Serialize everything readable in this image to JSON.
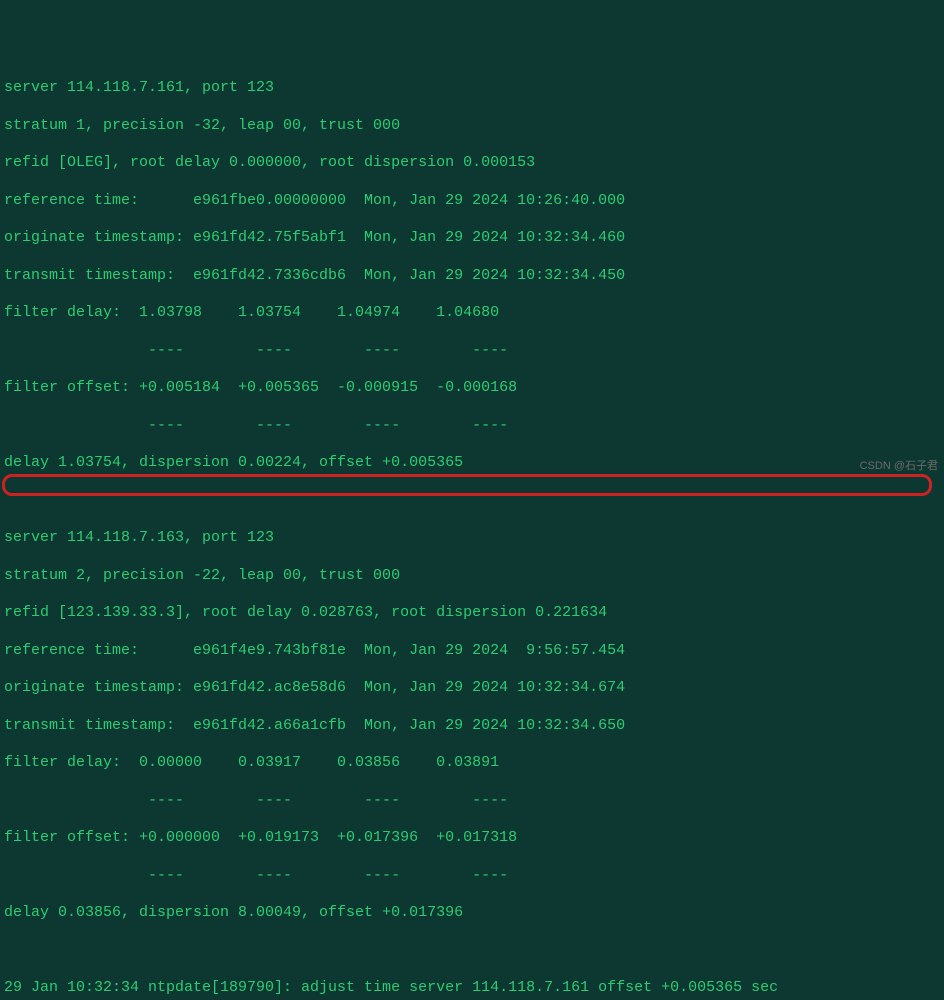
{
  "server1": {
    "header": "server 114.118.7.161, port 123",
    "stratum": "stratum 1, precision -32, leap 00, trust 000",
    "refid": "refid [OLEG], root delay 0.000000, root dispersion 0.000153",
    "reference_time": "reference time:      e961fbe0.00000000  Mon, Jan 29 2024 10:26:40.000",
    "originate_ts": "originate timestamp: e961fd42.75f5abf1  Mon, Jan 29 2024 10:32:34.460",
    "transmit_ts": "transmit timestamp:  e961fd42.7336cdb6  Mon, Jan 29 2024 10:32:34.450",
    "filter_delay": "filter delay:  1.03798    1.03754    1.04974    1.04680",
    "filter_delay_dashes": "                ----        ----        ----        ----",
    "filter_offset": "filter offset: +0.005184  +0.005365  -0.000915  -0.000168",
    "filter_offset_dashes": "                ----        ----        ----        ----",
    "summary": "delay 1.03754, dispersion 0.00224, offset +0.005365"
  },
  "server2": {
    "header": "server 114.118.7.163, port 123",
    "stratum": "stratum 2, precision -22, leap 00, trust 000",
    "refid": "refid [123.139.33.3], root delay 0.028763, root dispersion 0.221634",
    "reference_time": "reference time:      e961f4e9.743bf81e  Mon, Jan 29 2024  9:56:57.454",
    "originate_ts": "originate timestamp: e961fd42.ac8e58d6  Mon, Jan 29 2024 10:32:34.674",
    "transmit_ts": "transmit timestamp:  e961fd42.a66a1cfb  Mon, Jan 29 2024 10:32:34.650",
    "filter_delay": "filter delay:  0.00000    0.03917    0.03856    0.03891",
    "filter_delay_dashes": "                ----        ----        ----        ----",
    "filter_offset": "filter offset: +0.000000  +0.019173  +0.017396  +0.017318",
    "filter_offset_dashes": "                ----        ----        ----        ----",
    "summary": "delay 0.03856, dispersion 8.00049, offset +0.017396"
  },
  "result": "29 Jan 10:32:34 ntpdate[189790]: adjust time server 114.118.7.161 offset +0.005365 sec",
  "watermark": "CSDN @石子君"
}
